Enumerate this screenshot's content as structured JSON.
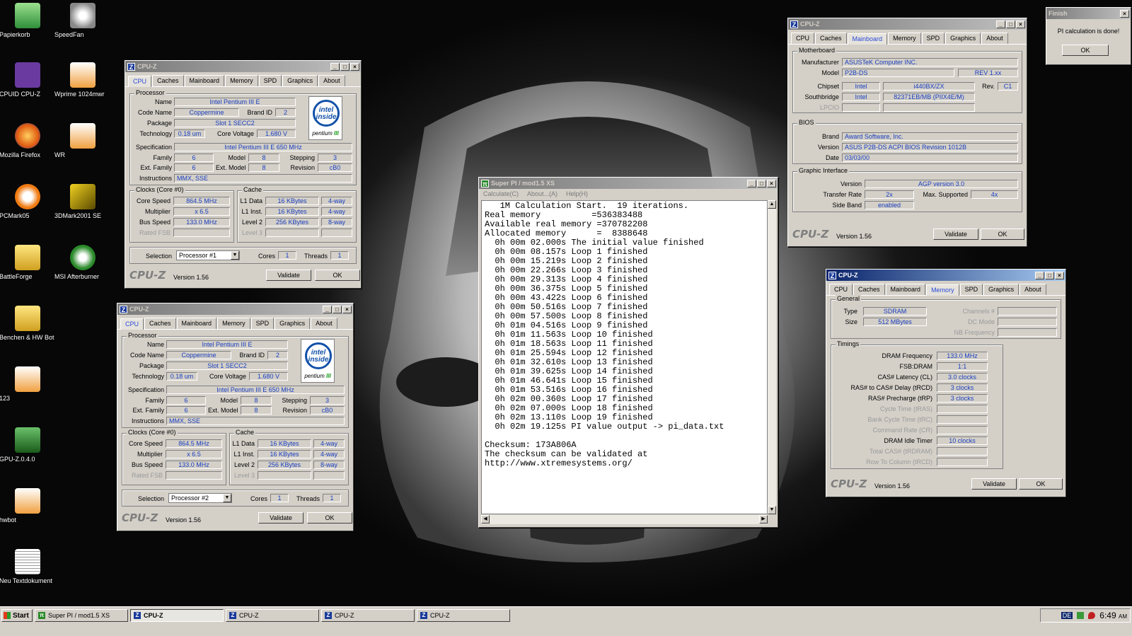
{
  "desktop": {
    "icons": [
      "Papierkorb",
      "SpeedFan",
      "CPUID CPU-Z",
      "Wprime 1024mwr",
      "Mozilla Firefox",
      "WR",
      "PCMark05",
      "3DMark2001 SE",
      "BattleForge",
      "MSI Afterburner",
      "Benchen & HW Bot",
      "123",
      "GPU-Z.0.4.0",
      "hwbot",
      "Neu Textdokument"
    ]
  },
  "cpuz": {
    "title": "CPU-Z",
    "tabs": [
      "CPU",
      "Caches",
      "Mainboard",
      "Memory",
      "SPD",
      "Graphics",
      "About"
    ],
    "brand": "CPU-Z",
    "version": "Version 1.56",
    "validate": "Validate",
    "ok": "OK"
  },
  "cpu": {
    "processor_group": "Processor",
    "name_label": "Name",
    "name": "Intel Pentium III E",
    "codename_label": "Code Name",
    "codename": "Coppermine",
    "brandid_label": "Brand ID",
    "brandid": "2",
    "package_label": "Package",
    "package": "Slot 1 SECC2",
    "tech_label": "Technology",
    "tech": "0.18 um",
    "corev_label": "Core Voltage",
    "corev": "1.680 V",
    "spec_label": "Specification",
    "spec": "Intel Pentium III E 650 MHz",
    "family_label": "Family",
    "family": "6",
    "model_label": "Model",
    "model": "8",
    "stepping_label": "Stepping",
    "stepping": "3",
    "extfam_label": "Ext. Family",
    "extfam": "6",
    "extmod_label": "Ext. Model",
    "extmod": "8",
    "rev_label": "Revision",
    "rev": "cB0",
    "instr_label": "Instructions",
    "instr": "MMX, SSE",
    "clocks_group": "Clocks (Core #0)",
    "corespeed_label": "Core Speed",
    "corespeed": "864.5 MHz",
    "mult_label": "Multiplier",
    "mult": "x 6.5",
    "bus_label": "Bus Speed",
    "bus": "133.0 MHz",
    "fsb_label": "Rated FSB",
    "cache_group": "Cache",
    "l1d_label": "L1 Data",
    "l1d": "16 KBytes",
    "l1d_way": "4-way",
    "l1i_label": "L1 Inst.",
    "l1i": "16 KBytes",
    "l1i_way": "4-way",
    "l2_label": "Level 2",
    "l2": "256 KBytes",
    "l2_way": "8-way",
    "l3_label": "Level 3",
    "sel_label": "Selection",
    "sel1": "Processor #1",
    "sel2": "Processor #2",
    "cores_label": "Cores",
    "cores": "1",
    "threads_label": "Threads",
    "threads": "1",
    "intel_text": "intel inside",
    "pentium": "pentium",
    "pentium_num": "III"
  },
  "mb": {
    "group": "Motherboard",
    "manu_label": "Manufacturer",
    "manu": "ASUSTeK Computer INC.",
    "model_label": "Model",
    "model": "P2B-DS",
    "rev": "REV 1.xx",
    "chipset_label": "Chipset",
    "chipset_v": "Intel",
    "chipset": "i440BX/ZX",
    "rev_label": "Rev.",
    "chiprev": "C1",
    "south_label": "Southbridge",
    "south_v": "Intel",
    "south": "82371EB/MB (PIIX4E/M)",
    "lpcio_label": "LPCIO",
    "bios_group": "BIOS",
    "brand_label": "Brand",
    "brand": "Award Software, Inc.",
    "version_label": "Version",
    "version": "ASUS P2B-DS ACPI BIOS Revision 1012B",
    "date_label": "Date",
    "date": "03/03/00",
    "gi_group": "Graphic Interface",
    "giver_label": "Version",
    "giver": "AGP version 3.0",
    "tr_label": "Transfer Rate",
    "tr": "2x",
    "max_label": "Max. Supported",
    "max": "4x",
    "sb_label": "Side Band",
    "sb": "enabled"
  },
  "mem": {
    "general": "General",
    "type_label": "Type",
    "type": "SDRAM",
    "size_label": "Size",
    "size": "512 MBytes",
    "ch_label": "Channels #",
    "dc_label": "DC Mode",
    "nb_label": "NB Frequency",
    "timings": "Timings",
    "dramf_label": "DRAM Frequency",
    "dramf": "133.0 MHz",
    "fsbd_label": "FSB:DRAM",
    "fsbd": "1:1",
    "cas_label": "CAS# Latency (CL)",
    "cas": "3.0 clocks",
    "rcd_label": "RAS# to CAS# Delay (tRCD)",
    "rcd": "3 clocks",
    "rp_label": "RAS# Precharge (tRP)",
    "rp": "3 clocks",
    "ras_label": "Cycle Time (tRAS)",
    "rc_label": "Bank Cycle Time (tRC)",
    "cr_label": "Command Rate (CR)",
    "idle_label": "DRAM Idle Timer",
    "idle": "10 clocks",
    "rdram_label": "Total CAS# (tRDRAM)",
    "rtc_label": "Row To Column (tRCD)"
  },
  "superpi": {
    "title": "Super PI / mod1.5 XS",
    "menu": [
      "Calculate(C)",
      "About...(A)",
      "Help(H)"
    ],
    "lines": [
      "   1M Calculation Start.  19 iterations.",
      "Real memory          =536383488",
      "Available real memory =370782208",
      "Allocated memory      =  8388648",
      "  0h 00m 02.000s The initial value finished",
      "  0h 00m 08.157s Loop 1 finished",
      "  0h 00m 15.219s Loop 2 finished",
      "  0h 00m 22.266s Loop 3 finished",
      "  0h 00m 29.313s Loop 4 finished",
      "  0h 00m 36.375s Loop 5 finished",
      "  0h 00m 43.422s Loop 6 finished",
      "  0h 00m 50.516s Loop 7 finished",
      "  0h 00m 57.500s Loop 8 finished",
      "  0h 01m 04.516s Loop 9 finished",
      "  0h 01m 11.563s Loop 10 finished",
      "  0h 01m 18.563s Loop 11 finished",
      "  0h 01m 25.594s Loop 12 finished",
      "  0h 01m 32.610s Loop 13 finished",
      "  0h 01m 39.625s Loop 14 finished",
      "  0h 01m 46.641s Loop 15 finished",
      "  0h 01m 53.516s Loop 16 finished",
      "  0h 02m 00.360s Loop 17 finished",
      "  0h 02m 07.000s Loop 18 finished",
      "  0h 02m 13.110s Loop 19 finished",
      "  0h 02m 19.125s PI value output -> pi_data.txt",
      "",
      "Checksum: 173A806A",
      "The checksum can be validated at",
      "http://www.xtremesystems.org/"
    ]
  },
  "finish": {
    "title": "Finish",
    "message": "PI calculation is done!",
    "ok": "OK"
  },
  "taskbar": {
    "start": "Start",
    "tasks": [
      "Super PI / mod1.5 XS",
      "CPU-Z",
      "CPU-Z",
      "CPU-Z",
      "CPU-Z"
    ],
    "lang": "DE",
    "time": "6:49",
    "time_suffix": "AM"
  }
}
